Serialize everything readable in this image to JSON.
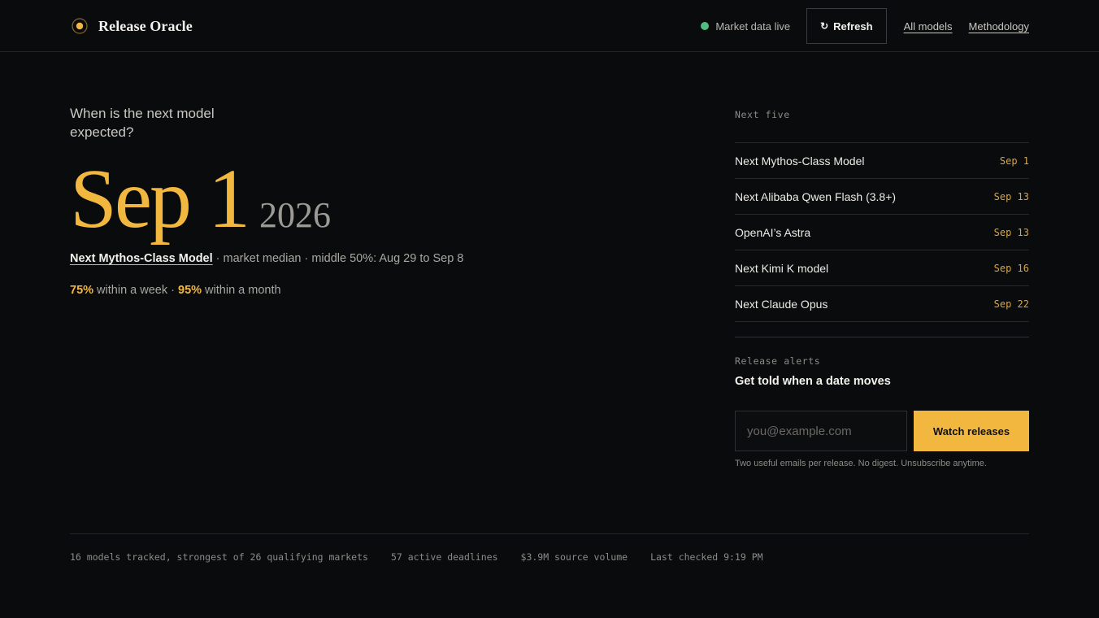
{
  "brand": {
    "name": "Release Oracle",
    "icon": "orbit-dot-icon"
  },
  "nav": {
    "live_status": "Market data live",
    "refresh_label": "Refresh",
    "refresh_icon": "↻",
    "links": [
      "All models",
      "Methodology"
    ]
  },
  "hero": {
    "question": "When is the next model expected?",
    "month_day": "Sep 1",
    "year": "2026",
    "model_name": "Next Mythos-Class Model",
    "median_text": " · market median · middle 50%: Aug 29 to Sep 8",
    "week_prob": "75%",
    "week_text": " within a week · ",
    "month_prob": "95%",
    "month_text": " within a month"
  },
  "next_five": {
    "label": "Next five",
    "items": [
      {
        "name": "Next Mythos-Class Model",
        "date": "Sep 1"
      },
      {
        "name": "Next Alibaba Qwen Flash (3.8+)",
        "date": "Sep 13"
      },
      {
        "name": "OpenAI’s Astra",
        "date": "Sep 13"
      },
      {
        "name": "Next Kimi K model",
        "date": "Sep 16"
      },
      {
        "name": "Next Claude Opus",
        "date": "Sep 22"
      }
    ]
  },
  "alerts": {
    "label": "Release alerts",
    "title": "Get told when a date moves",
    "email_placeholder": "you@example.com",
    "button_label": "Watch releases",
    "note": "Two useful emails per release. No digest. Unsubscribe anytime."
  },
  "footer": {
    "stats": [
      "16 models tracked, strongest of 26 qualifying markets",
      "57 active deadlines",
      "$3.9M source volume",
      "Last checked 9:19 PM"
    ]
  },
  "colors": {
    "accent": "#f2b73f",
    "live": "#4fbf7f",
    "background": "#0a0b0d"
  }
}
